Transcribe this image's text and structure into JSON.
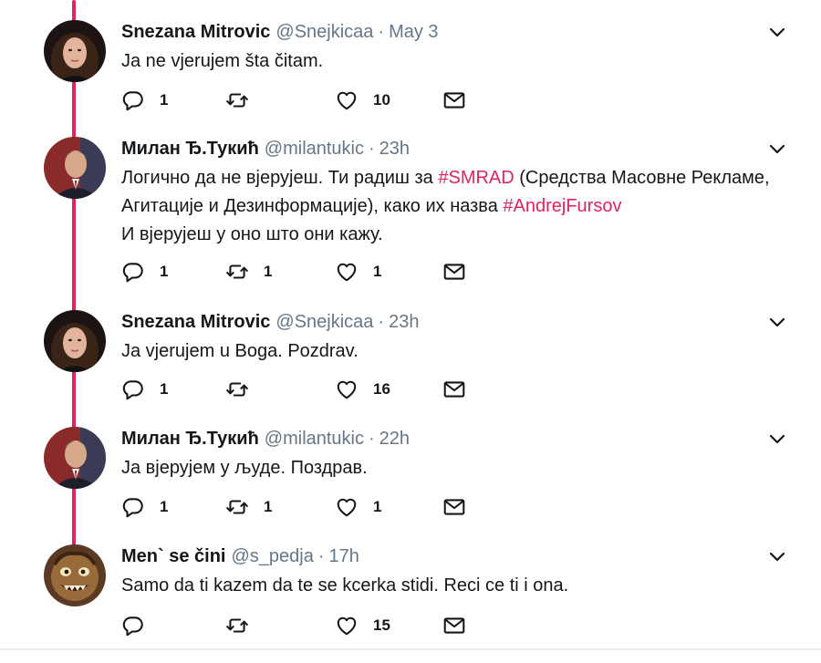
{
  "colors": {
    "accent": "#e0245e",
    "muted": "#657786",
    "text": "#14171a",
    "icon": "#14171a"
  },
  "tweets": [
    {
      "name": "Snezana Mitrovic",
      "handle": "@Snejkicaa",
      "time": "May 3",
      "lines": [
        [
          {
            "t": "Ja ne vjerujem šta čitam."
          }
        ]
      ],
      "reply_count": "1",
      "retweet_count": "",
      "like_count": "10",
      "avatar": "woman-portrait"
    },
    {
      "name": "Милан Ђ.Тукић",
      "handle": "@milantukic",
      "time": "23h",
      "lines": [
        [
          {
            "t": "Логично да не вјерујеш. Ти радиш за "
          },
          {
            "t": "#SMRAD",
            "tag": true
          },
          {
            "t": " (Средства Масовне Рекламе,"
          }
        ],
        [
          {
            "t": "Агитације и Дезинформације), како их назва "
          },
          {
            "t": "#AndrejFursov",
            "tag": true
          }
        ],
        [
          {
            "t": "И вјерујеш у оно што они кажу."
          }
        ]
      ],
      "reply_count": "1",
      "retweet_count": "1",
      "like_count": "1",
      "avatar": "man-portrait"
    },
    {
      "name": "Snezana Mitrovic",
      "handle": "@Snejkicaa",
      "time": "23h",
      "lines": [
        [
          {
            "t": "Ja vjerujem u Boga. Pozdrav."
          }
        ]
      ],
      "reply_count": "1",
      "retweet_count": "",
      "like_count": "16",
      "avatar": "woman-portrait"
    },
    {
      "name": "Милан Ђ.Тукић",
      "handle": "@milantukic",
      "time": "22h",
      "lines": [
        [
          {
            "t": "Ja вјерујем у људе. Поздрав."
          }
        ]
      ],
      "reply_count": "1",
      "retweet_count": "1",
      "like_count": "1",
      "avatar": "man-portrait"
    },
    {
      "name": "Men` se čini",
      "handle": "@s_pedja",
      "time": "17h",
      "lines": [
        [
          {
            "t": "Samo da ti kazem da te se kcerka stidi. Reci ce ti i ona."
          }
        ]
      ],
      "reply_count": "",
      "retweet_count": "",
      "like_count": "15",
      "avatar": "cartoon-monster"
    }
  ]
}
